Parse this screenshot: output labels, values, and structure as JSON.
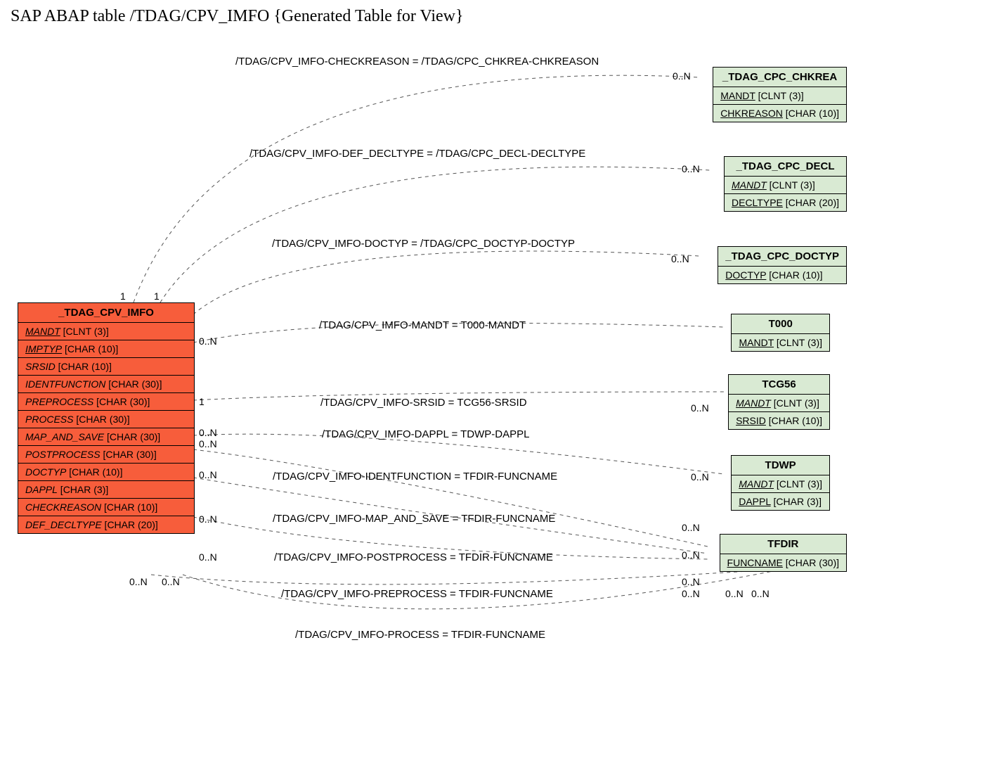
{
  "page_title": "SAP ABAP table /TDAG/CPV_IMFO {Generated Table for View}",
  "relationships": [
    {
      "label": "/TDAG/CPV_IMFO-CHECKREASON = /TDAG/CPC_CHKREA-CHKREASON",
      "left_card": "1",
      "right_card": "0..N"
    },
    {
      "label": "/TDAG/CPV_IMFO-DEF_DECLTYPE = /TDAG/CPC_DECL-DECLTYPE",
      "left_card": "1",
      "right_card": "0..N"
    },
    {
      "label": "/TDAG/CPV_IMFO-DOCTYP = /TDAG/CPC_DOCTYP-DOCTYP",
      "left_card": "",
      "right_card": "0..N"
    },
    {
      "label": "/TDAG/CPV_IMFO-MANDT = T000-MANDT",
      "left_card": "0..N",
      "right_card": ""
    },
    {
      "label": "/TDAG/CPV_IMFO-SRSID = TCG56-SRSID",
      "left_card": "1",
      "right_card": "0..N"
    },
    {
      "label": "/TDAG/CPV_IMFO-DAPPL = TDWP-DAPPL",
      "left_card": "0..N",
      "right_card": "0..N"
    },
    {
      "label": "/TDAG/CPV_IMFO-IDENTFUNCTION = TFDIR-FUNCNAME",
      "left_card": "0..N",
      "right_card": "0..N"
    },
    {
      "label": "/TDAG/CPV_IMFO-MAP_AND_SAVE = TFDIR-FUNCNAME",
      "left_card": "0..N",
      "right_card": "0..N"
    },
    {
      "label": "/TDAG/CPV_IMFO-POSTPROCESS = TFDIR-FUNCNAME",
      "left_card": "0..N",
      "right_card": "0..N"
    },
    {
      "label": "/TDAG/CPV_IMFO-PREPROCESS = TFDIR-FUNCNAME",
      "left_card": "0..N",
      "right_card": "0..N"
    },
    {
      "label": "/TDAG/CPV_IMFO-PROCESS = TFDIR-FUNCNAME",
      "left_card": "0..N",
      "right_card": "0..N"
    }
  ],
  "extra_card": "0..N",
  "main_entity": {
    "name": "_TDAG_CPV_IMFO",
    "rows": [
      {
        "name": "MANDT",
        "type": "[CLNT (3)]",
        "underline": true
      },
      {
        "name": "IMPTYP",
        "type": "[CHAR (10)]",
        "underline": true
      },
      {
        "name": "SRSID",
        "type": "[CHAR (10)]",
        "underline": false
      },
      {
        "name": "IDENTFUNCTION",
        "type": "[CHAR (30)]",
        "underline": false
      },
      {
        "name": "PREPROCESS",
        "type": "[CHAR (30)]",
        "underline": false
      },
      {
        "name": "PROCESS",
        "type": "[CHAR (30)]",
        "underline": false
      },
      {
        "name": "MAP_AND_SAVE",
        "type": "[CHAR (30)]",
        "underline": false
      },
      {
        "name": "POSTPROCESS",
        "type": "[CHAR (30)]",
        "underline": false
      },
      {
        "name": "DOCTYP",
        "type": "[CHAR (10)]",
        "underline": false
      },
      {
        "name": "DAPPL",
        "type": "[CHAR (3)]",
        "underline": false
      },
      {
        "name": "CHECKREASON",
        "type": "[CHAR (10)]",
        "underline": false
      },
      {
        "name": "DEF_DECLTYPE",
        "type": "[CHAR (20)]",
        "underline": false
      }
    ]
  },
  "entities": [
    {
      "name": "_TDAG_CPC_CHKREA",
      "rows": [
        {
          "name": "MANDT",
          "type": "[CLNT (3)]",
          "underline": true
        },
        {
          "name": "CHKREASON",
          "type": "[CHAR (10)]",
          "underline": true
        }
      ]
    },
    {
      "name": "_TDAG_CPC_DECL",
      "rows": [
        {
          "name": "MANDT",
          "type": "[CLNT (3)]",
          "underline": true,
          "italic": true
        },
        {
          "name": "DECLTYPE",
          "type": "[CHAR (20)]",
          "underline": true
        }
      ]
    },
    {
      "name": "_TDAG_CPC_DOCTYP",
      "rows": [
        {
          "name": "DOCTYP",
          "type": "[CHAR (10)]",
          "underline": true
        }
      ]
    },
    {
      "name": "T000",
      "rows": [
        {
          "name": "MANDT",
          "type": "[CLNT (3)]",
          "underline": true
        }
      ]
    },
    {
      "name": "TCG56",
      "rows": [
        {
          "name": "MANDT",
          "type": "[CLNT (3)]",
          "underline": true,
          "italic": true
        },
        {
          "name": "SRSID",
          "type": "[CHAR (10)]",
          "underline": true
        }
      ]
    },
    {
      "name": "TDWP",
      "rows": [
        {
          "name": "MANDT",
          "type": "[CLNT (3)]",
          "underline": true,
          "italic": true
        },
        {
          "name": "DAPPL",
          "type": "[CHAR (3)]",
          "underline": true
        }
      ]
    },
    {
      "name": "TFDIR",
      "rows": [
        {
          "name": "FUNCNAME",
          "type": "[CHAR (30)]",
          "underline": true
        }
      ]
    }
  ]
}
